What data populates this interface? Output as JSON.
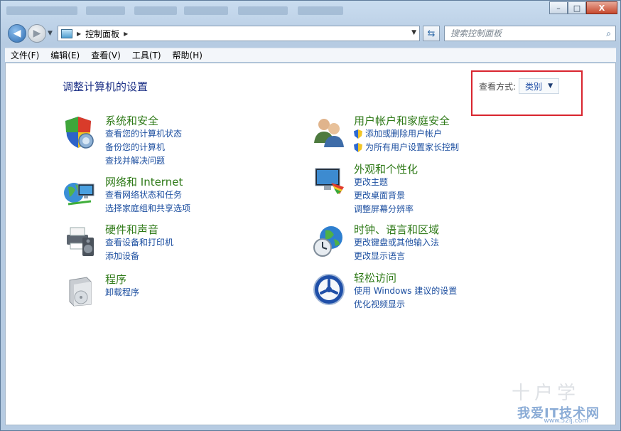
{
  "window": {
    "caption": {
      "minimize": "–",
      "maximize": "□",
      "close": "X"
    }
  },
  "nav": {
    "address": {
      "root": "控制面板"
    },
    "search_placeholder": "搜索控制面板"
  },
  "menu": [
    "文件(F)",
    "编辑(E)",
    "查看(V)",
    "工具(T)",
    "帮助(H)"
  ],
  "page": {
    "title": "调整计算机的设置",
    "view_by_label": "查看方式:",
    "view_by_value": "类别"
  },
  "categories": [
    {
      "id": "system-security",
      "title": "系统和安全",
      "icon": "shield-icon",
      "links": [
        {
          "text": "查看您的计算机状态"
        },
        {
          "text": "备份您的计算机"
        },
        {
          "text": "查找并解决问题"
        }
      ]
    },
    {
      "id": "network-internet",
      "title": "网络和 Internet",
      "icon": "network-globe-icon",
      "links": [
        {
          "text": "查看网络状态和任务"
        },
        {
          "text": "选择家庭组和共享选项"
        }
      ]
    },
    {
      "id": "hardware-sound",
      "title": "硬件和声音",
      "icon": "printer-speaker-icon",
      "links": [
        {
          "text": "查看设备和打印机"
        },
        {
          "text": "添加设备"
        }
      ]
    },
    {
      "id": "programs",
      "title": "程序",
      "icon": "programs-box-icon",
      "links": [
        {
          "text": "卸载程序"
        }
      ]
    },
    {
      "id": "user-accounts",
      "title": "用户帐户和家庭安全",
      "icon": "users-icon",
      "links": [
        {
          "text": "添加或删除用户帐户",
          "shield": true
        },
        {
          "text": "为所有用户设置家长控制",
          "shield": true
        }
      ]
    },
    {
      "id": "appearance",
      "title": "外观和个性化",
      "icon": "monitor-palette-icon",
      "links": [
        {
          "text": "更改主题"
        },
        {
          "text": "更改桌面背景"
        },
        {
          "text": "调整屏幕分辨率"
        }
      ]
    },
    {
      "id": "clock-region",
      "title": "时钟、语言和区域",
      "icon": "clock-globe-icon",
      "links": [
        {
          "text": "更改键盘或其他输入法"
        },
        {
          "text": "更改显示语言"
        }
      ]
    },
    {
      "id": "ease-of-access",
      "title": "轻松访问",
      "icon": "ease-of-access-icon",
      "links": [
        {
          "text": "使用 Windows 建议的设置"
        },
        {
          "text": "优化视频显示"
        }
      ]
    }
  ],
  "watermark": {
    "text": "我爱IT技术网",
    "sub": "www.52ij.com",
    "deco": "十户学"
  },
  "colors": {
    "category_title": "#2f7a18",
    "link": "#1d4fa0",
    "page_title": "#1e3287",
    "highlight_box": "#d9252f"
  }
}
